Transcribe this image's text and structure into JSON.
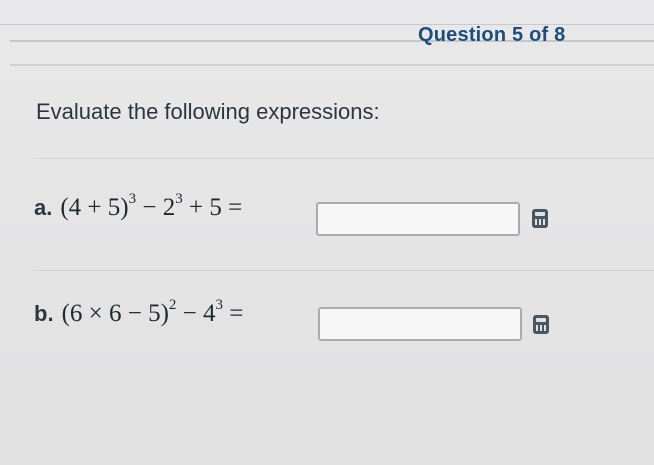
{
  "header": {
    "question_counter": "Question 5 of 8"
  },
  "instructions": "Evaluate the following expressions:",
  "problems": [
    {
      "letter": "a.",
      "expr": {
        "p1": "(4 + 5)",
        "e1": "3",
        "p2": " − 2",
        "e2": "3",
        "p3": " + 5 ="
      },
      "answer_value": "",
      "keypad_icon": "keypad-icon"
    },
    {
      "letter": "b.",
      "expr": {
        "p1": "(6 × 6 − 5)",
        "e1": "2",
        "p2": " − 4",
        "e2": "3",
        "p3": " ="
      },
      "answer_value": "",
      "keypad_icon": "keypad-icon"
    }
  ],
  "colors": {
    "accent": "#1d4d78",
    "text": "#2c3640",
    "background": "#e6e6e6"
  }
}
